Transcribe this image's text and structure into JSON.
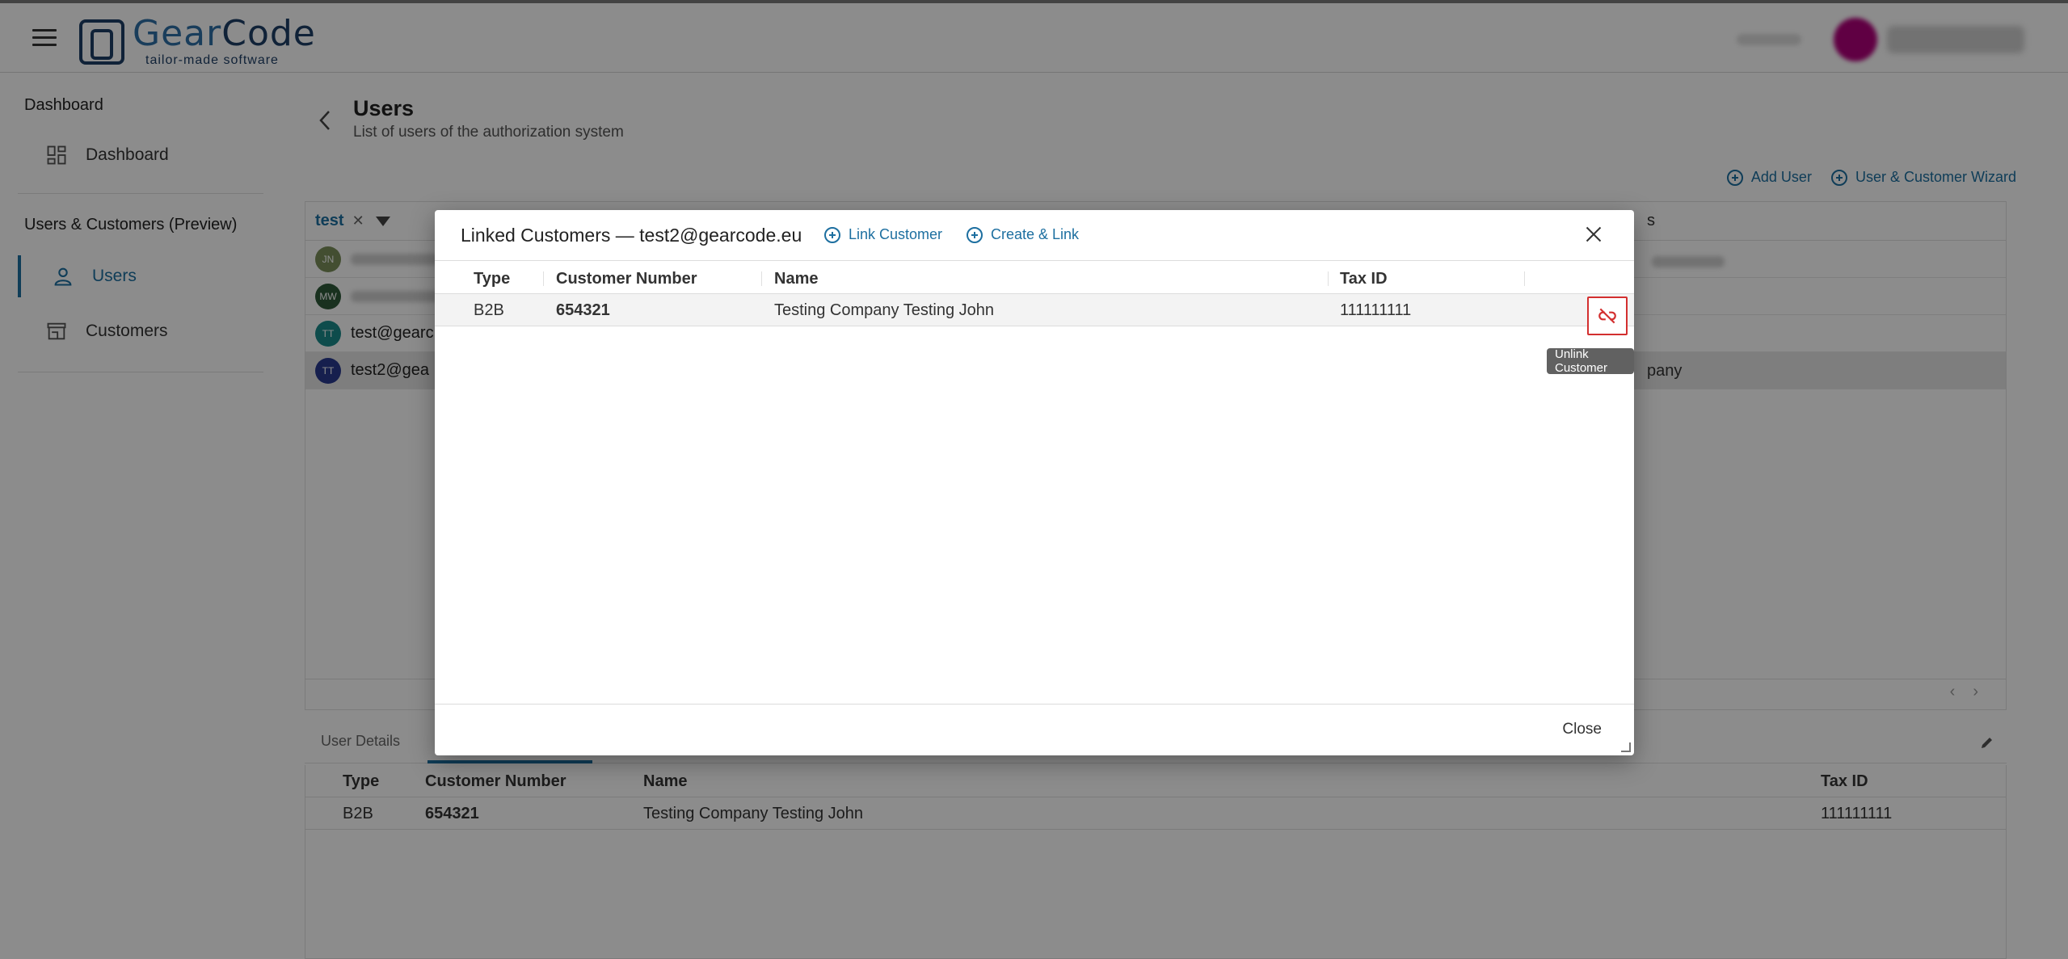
{
  "header": {
    "logo_name_a": "Gear",
    "logo_name_b": "Code",
    "logo_tagline": "tailor-made software"
  },
  "sidebar": {
    "section1": "Dashboard",
    "dashboard_item": "Dashboard",
    "section2": "Users & Customers (Preview)",
    "users_item": "Users",
    "customers_item": "Customers"
  },
  "page": {
    "title": "Users",
    "subtitle": "List of users of the authorization system",
    "add_user": "Add User",
    "wizard": "User & Customer Wizard"
  },
  "users_list": {
    "filter_value": "test",
    "rows": [
      {
        "initials": "JN",
        "color": "#7a8f5a"
      },
      {
        "initials": "MW",
        "color": "#2f5a3a"
      },
      {
        "initials": "TT",
        "color": "#1a8a8a",
        "email": "test@gearc"
      },
      {
        "initials": "TT",
        "color": "#283a8f",
        "email": "test2@gea"
      }
    ],
    "right_col_header": "s",
    "right_col_row4": "pany"
  },
  "details": {
    "tab_user_details": "User Details",
    "columns": [
      "Type",
      "Customer Number",
      "Name",
      "Tax ID"
    ],
    "row": {
      "type": "B2B",
      "customer_number": "654321",
      "name": "Testing Company Testing John",
      "tax_id": "111111111"
    }
  },
  "modal": {
    "title": "Linked Customers — test2@gearcode.eu",
    "link_customer": "Link Customer",
    "create_link": "Create & Link",
    "columns": [
      "Type",
      "Customer Number",
      "Name",
      "Tax ID"
    ],
    "row": {
      "type": "B2B",
      "customer_number": "654321",
      "name": "Testing Company Testing John",
      "tax_id": "111111111"
    },
    "unlink_tooltip": "Unlink Customer",
    "close": "Close"
  },
  "colors": {
    "accent": "#1d6fa0",
    "danger": "#d32f2f",
    "brand_dark": "#1e3f66"
  }
}
